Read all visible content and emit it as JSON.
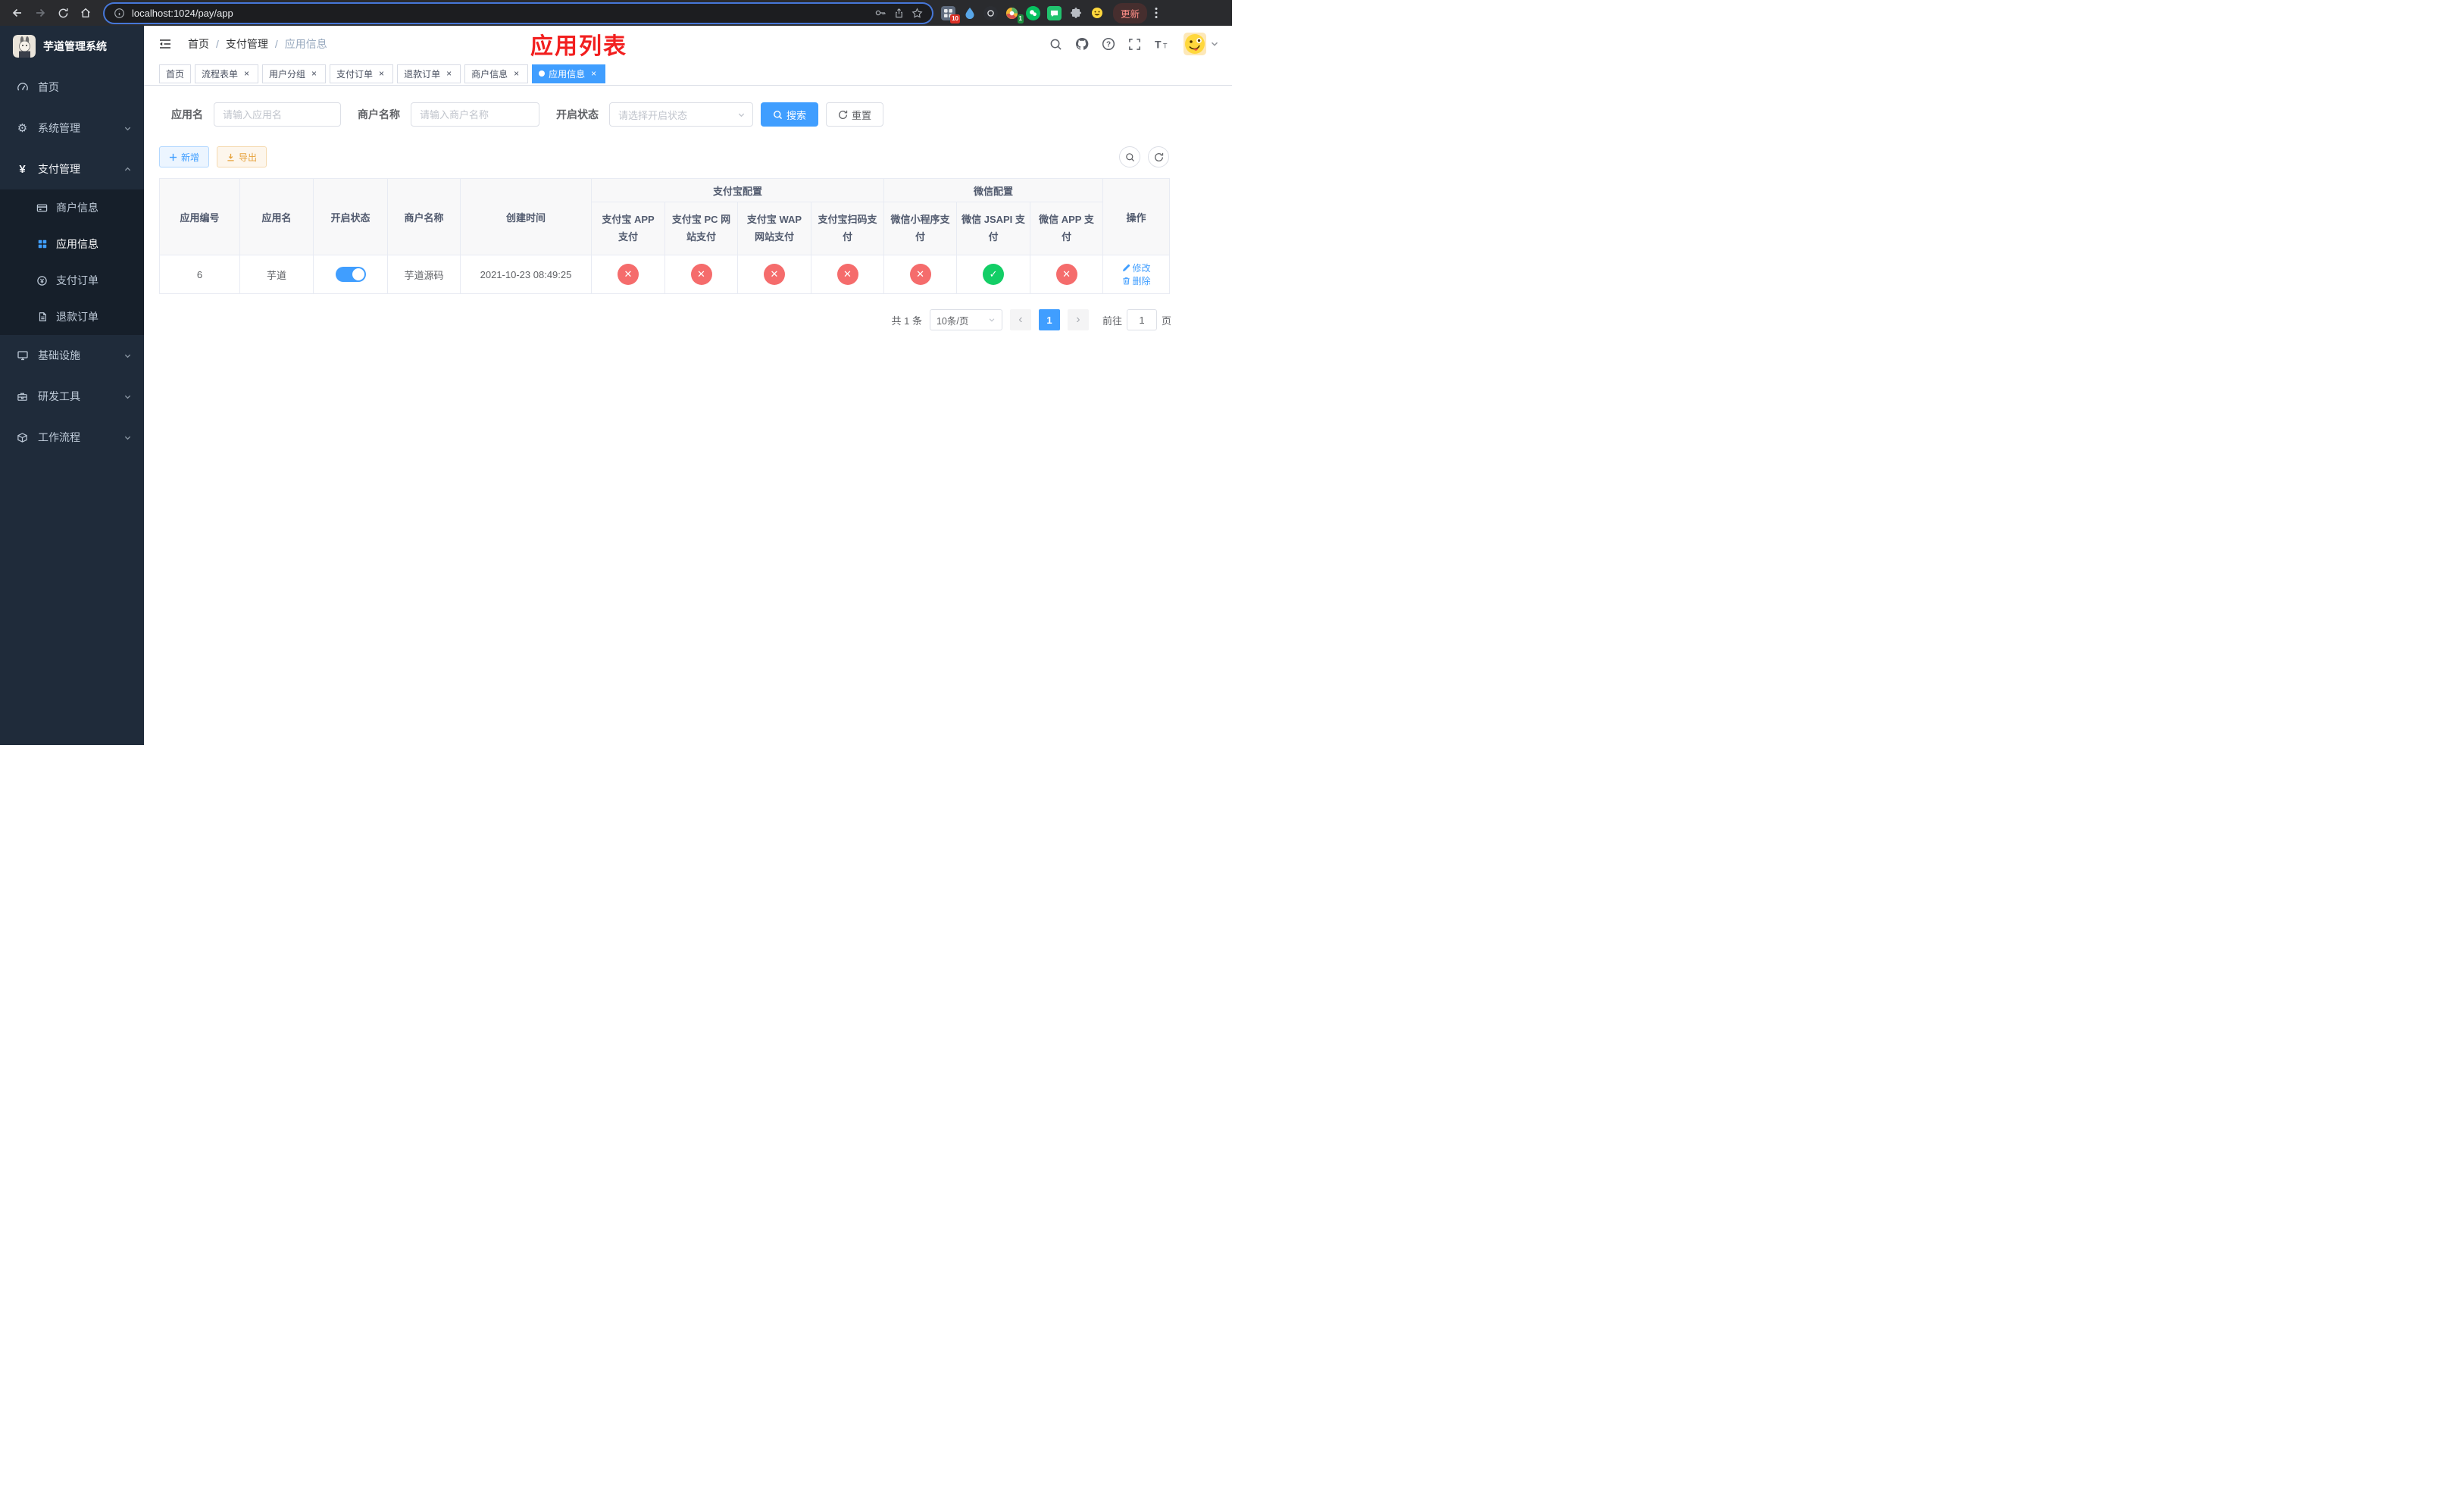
{
  "browser": {
    "url": "localhost:1024/pay/app",
    "update_button": "更新",
    "extension_badges": {
      "grid": "10",
      "colorful": "1"
    }
  },
  "sidebar": {
    "app_title": "芋道管理系统",
    "menu": [
      {
        "label": "首页"
      },
      {
        "label": "系统管理"
      },
      {
        "label": "支付管理"
      },
      {
        "label": "基础设施"
      },
      {
        "label": "研发工具"
      },
      {
        "label": "工作流程"
      }
    ],
    "pay_submenu": [
      {
        "label": "商户信息"
      },
      {
        "label": "应用信息"
      },
      {
        "label": "支付订单"
      },
      {
        "label": "退款订单"
      }
    ]
  },
  "header": {
    "breadcrumb": [
      "首页",
      "支付管理",
      "应用信息"
    ],
    "separator": "/",
    "overlay_title": "应用列表"
  },
  "tabs": [
    {
      "label": "首页"
    },
    {
      "label": "流程表单"
    },
    {
      "label": "用户分组"
    },
    {
      "label": "支付订单"
    },
    {
      "label": "退款订单"
    },
    {
      "label": "商户信息"
    },
    {
      "label": "应用信息"
    }
  ],
  "filters": {
    "app_name_label": "应用名",
    "app_name_placeholder": "请输入应用名",
    "merchant_label": "商户名称",
    "merchant_placeholder": "请输入商户名称",
    "status_label": "开启状态",
    "status_placeholder": "请选择开启状态",
    "search_button": "搜索",
    "reset_button": "重置"
  },
  "toolbar": {
    "add_button": "新增",
    "export_button": "导出"
  },
  "table": {
    "columns": {
      "app_id": "应用编号",
      "app_name": "应用名",
      "status": "开启状态",
      "merchant": "商户名称",
      "created": "创建时间",
      "alipay_group": "支付宝配置",
      "wechat_group": "微信配置",
      "actions": "操作"
    },
    "channel_columns": [
      "支付宝 APP 支付",
      "支付宝 PC 网站支付",
      "支付宝 WAP 网站支付",
      "支付宝扫码支付",
      "微信小程序支付",
      "微信 JSAPI 支付",
      "微信 APP 支付"
    ],
    "row": {
      "app_id": "6",
      "app_name": "芋道",
      "status_on": true,
      "merchant": "芋道源码",
      "created": "2021-10-23 08:49:25",
      "channels": [
        false,
        false,
        false,
        false,
        false,
        true,
        false
      ],
      "edit_label": "修改",
      "delete_label": "删除"
    }
  },
  "pagination": {
    "total_text": "共 1 条",
    "page_size": "10条/页",
    "current_page": "1",
    "prev_glyph": "‹",
    "next_glyph": "›",
    "goto_label": "前往",
    "goto_value": "1",
    "goto_suffix": "页"
  },
  "icons": {
    "check_glyph": "✓",
    "close_glyph": "✕",
    "tab_close_glyph": "×"
  },
  "colors": {
    "primary": "#409eff",
    "success": "#13ce66",
    "danger": "#f56c6c",
    "warning": "#e6a23c",
    "overlay_title": "#f21f1f",
    "sidebar_bg": "#1f2b3a",
    "submenu_bg": "#161f2a"
  }
}
